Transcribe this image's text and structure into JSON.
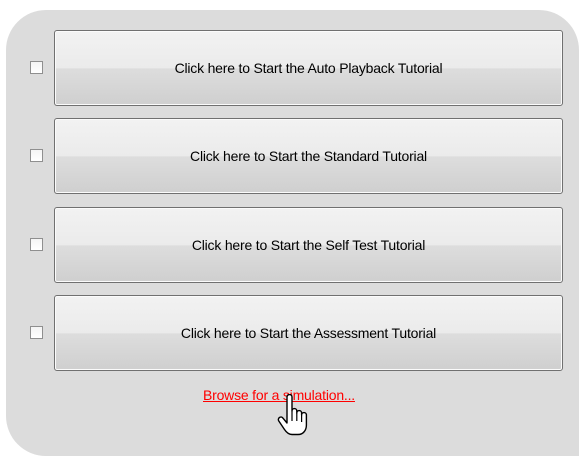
{
  "tutorials": [
    {
      "label": "Click here to Start the Auto Playback Tutorial",
      "checked": false
    },
    {
      "label": "Click here to Start the Standard Tutorial",
      "checked": false
    },
    {
      "label": "Click here to Start the Self Test Tutorial",
      "checked": false
    },
    {
      "label": "Click here to Start the Assessment Tutorial",
      "checked": false
    }
  ],
  "browse_link": "Browse for a simulation...",
  "cursor_icon": "hand-pointer-icon",
  "colors": {
    "panel_background": "#dcdcdc",
    "link": "#ff0000"
  }
}
